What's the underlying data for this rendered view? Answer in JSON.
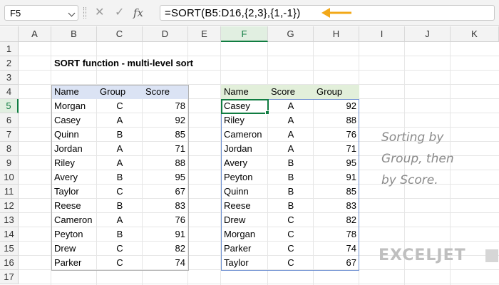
{
  "formula_bar": {
    "name_box": "F5",
    "formula": "=SORT(B5:D16,{2,3},{1,-1})",
    "fx_label": "fx",
    "cancel_glyph": "✕",
    "enter_glyph": "✓"
  },
  "columns": [
    "A",
    "B",
    "C",
    "D",
    "E",
    "F",
    "G",
    "H",
    "I",
    "J",
    "K"
  ],
  "rows": [
    "1",
    "2",
    "3",
    "4",
    "5",
    "6",
    "7",
    "8",
    "9",
    "10",
    "11",
    "12",
    "13",
    "14",
    "15",
    "16",
    "17"
  ],
  "selected_column": "F",
  "selected_row": "5",
  "title": "SORT function - multi-level sort",
  "source_table": {
    "headers": [
      "Name",
      "Group",
      "Score"
    ],
    "rows": [
      [
        "Morgan",
        "C",
        "78"
      ],
      [
        "Casey",
        "A",
        "92"
      ],
      [
        "Quinn",
        "B",
        "85"
      ],
      [
        "Jordan",
        "A",
        "71"
      ],
      [
        "Riley",
        "A",
        "88"
      ],
      [
        "Avery",
        "B",
        "95"
      ],
      [
        "Taylor",
        "C",
        "67"
      ],
      [
        "Reese",
        "B",
        "83"
      ],
      [
        "Cameron",
        "A",
        "76"
      ],
      [
        "Peyton",
        "B",
        "91"
      ],
      [
        "Drew",
        "C",
        "82"
      ],
      [
        "Parker",
        "C",
        "74"
      ]
    ]
  },
  "result_table": {
    "headers": [
      "Name",
      "Score",
      "Group"
    ],
    "rows": [
      [
        "Casey",
        "A",
        "92"
      ],
      [
        "Riley",
        "A",
        "88"
      ],
      [
        "Cameron",
        "A",
        "76"
      ],
      [
        "Jordan",
        "A",
        "71"
      ],
      [
        "Avery",
        "B",
        "95"
      ],
      [
        "Peyton",
        "B",
        "91"
      ],
      [
        "Quinn",
        "B",
        "85"
      ],
      [
        "Reese",
        "B",
        "83"
      ],
      [
        "Drew",
        "C",
        "82"
      ],
      [
        "Morgan",
        "C",
        "78"
      ],
      [
        "Parker",
        "C",
        "74"
      ],
      [
        "Taylor",
        "C",
        "67"
      ]
    ]
  },
  "note_lines": [
    "Sorting by",
    "Group, then",
    "by Score."
  ],
  "logo": "EXCELJET",
  "colors": {
    "accent_green": "#107c41",
    "header_blue": "#dbe3f4",
    "header_green": "#e2efda",
    "arrow_orange": "#f2a818"
  }
}
